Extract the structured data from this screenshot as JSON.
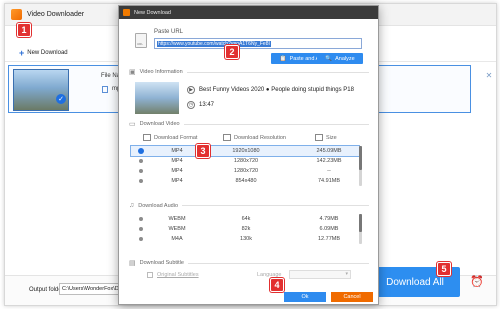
{
  "main_window": {
    "title": "Video Downloader",
    "new_download_label": "New Download",
    "file_name_label": "File Name",
    "format_label": "mp4",
    "output_folder_label": "Output folder:",
    "output_folder_value": "C:\\Users\\WonderFox\\Desktop",
    "download_all_label": "Download All"
  },
  "dialog": {
    "title": "New Download",
    "paste_url_label": "Paste URL",
    "url_value": "https://www.youtube.com/watch?v=oA1T6Ny_Fe8I",
    "paste_analyze_label": "Paste and Analyze",
    "analyze_label": "Analyze",
    "video_info_heading": "Video Information",
    "video_title": "Best Funny Videos 2020 ● People doing stupid things P18",
    "video_duration": "13:47",
    "download_video_heading": "Download Video",
    "columns": {
      "format": "Download Format",
      "resolution": "Download Resolution",
      "size": "Size"
    },
    "video_rows": [
      {
        "format": "MP4",
        "resolution": "1920x1080",
        "size": "245.09MB",
        "selected": true
      },
      {
        "format": "MP4",
        "resolution": "1280x720",
        "size": "142.23MB",
        "selected": false
      },
      {
        "format": "MP4",
        "resolution": "1280x720",
        "size": "--",
        "selected": false
      },
      {
        "format": "MP4",
        "resolution": "854x480",
        "size": "74.91MB",
        "selected": false
      }
    ],
    "download_audio_heading": "Download Audio",
    "audio_rows": [
      {
        "format": "WEBM",
        "resolution": "64k",
        "size": "4.79MB"
      },
      {
        "format": "WEBM",
        "resolution": "82k",
        "size": "6.09MB"
      },
      {
        "format": "M4A",
        "resolution": "130k",
        "size": "12.77MB"
      }
    ],
    "download_subtitle_heading": "Download Subtitle",
    "original_subtitles_label": "Original Subtitles",
    "language_label": "Language",
    "ok_label": "Ok",
    "cancel_label": "Cancel"
  },
  "badges": [
    "1",
    "2",
    "3",
    "4",
    "5"
  ],
  "colors": {
    "accent_blue": "#2e8bef",
    "cancel_orange": "#f06b00",
    "badge_red": "#e23030",
    "dialog_titlebar": "#3b3b3b"
  }
}
